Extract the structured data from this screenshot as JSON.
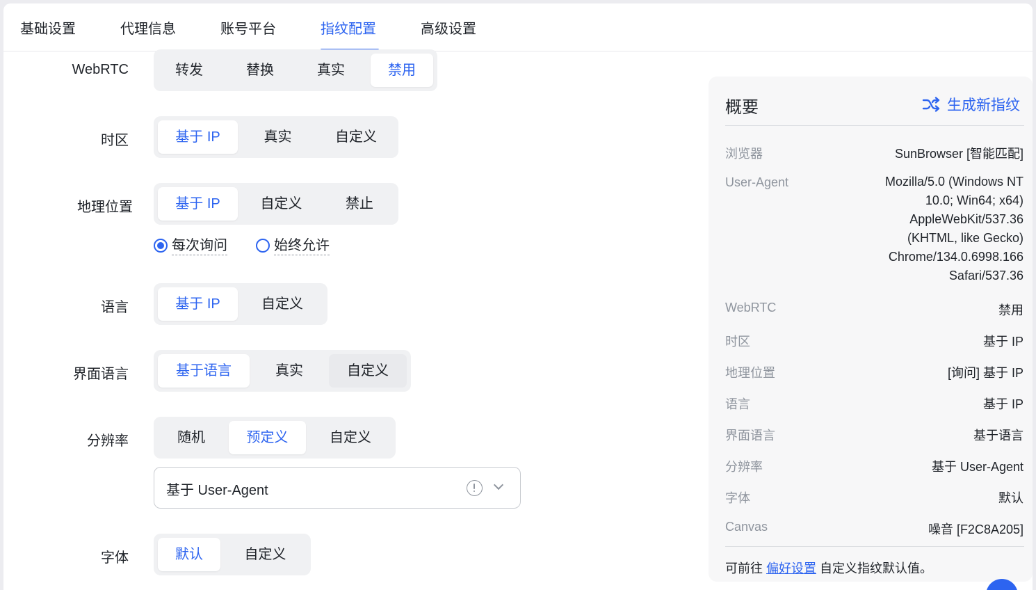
{
  "tabs": [
    "基础设置",
    "代理信息",
    "账号平台",
    "指纹配置",
    "高级设置"
  ],
  "active_tab": "指纹配置",
  "form": {
    "webrtc": {
      "label": "WebRTC",
      "options": [
        "转发",
        "替换",
        "真实",
        "禁用"
      ],
      "selected": "禁用"
    },
    "timezone": {
      "label": "时区",
      "options": [
        "基于 IP",
        "真实",
        "自定义"
      ],
      "selected": "基于 IP"
    },
    "geolocation": {
      "label": "地理位置",
      "options": [
        "基于 IP",
        "自定义",
        "禁止"
      ],
      "selected": "基于 IP",
      "radios": [
        "每次询问",
        "始终允许"
      ],
      "radio_selected": "每次询问"
    },
    "language": {
      "label": "语言",
      "options": [
        "基于 IP",
        "自定义"
      ],
      "selected": "基于 IP"
    },
    "ui_language": {
      "label": "界面语言",
      "options": [
        "基于语言",
        "真实",
        "自定义"
      ],
      "selected": "基于语言"
    },
    "resolution": {
      "label": "分辨率",
      "options": [
        "随机",
        "预定义",
        "自定义"
      ],
      "selected": "预定义",
      "select_value": "基于 User-Agent"
    },
    "fonts": {
      "label": "字体",
      "options": [
        "默认",
        "自定义"
      ],
      "selected": "默认"
    }
  },
  "summary": {
    "title": "概要",
    "generate_label": "生成新指纹",
    "rows": [
      {
        "key": "浏览器",
        "value": "SunBrowser [智能匹配]"
      },
      {
        "key": "User-Agent",
        "value": "Mozilla/5.0 (Windows NT 10.0; Win64; x64) AppleWebKit/537.36 (KHTML, like Gecko) Chrome/134.0.6998.166 Safari/537.36"
      },
      {
        "key": "WebRTC",
        "value": "禁用"
      },
      {
        "key": "时区",
        "value": "基于 IP"
      },
      {
        "key": "地理位置",
        "value": "[询问] 基于 IP"
      },
      {
        "key": "语言",
        "value": "基于 IP"
      },
      {
        "key": "界面语言",
        "value": "基于语言"
      },
      {
        "key": "分辨率",
        "value": "基于 User-Agent"
      },
      {
        "key": "字体",
        "value": "默认"
      },
      {
        "key": "Canvas",
        "value": "噪音 [F2C8A205]"
      }
    ],
    "footer_prefix": "可前往",
    "footer_link": "偏好设置",
    "footer_suffix": "自定义指纹默认值。"
  },
  "colors": {
    "accent": "#2d64f0",
    "text": "#1f2329",
    "muted": "#8f959e",
    "segment_bg": "#f0f1f3"
  }
}
